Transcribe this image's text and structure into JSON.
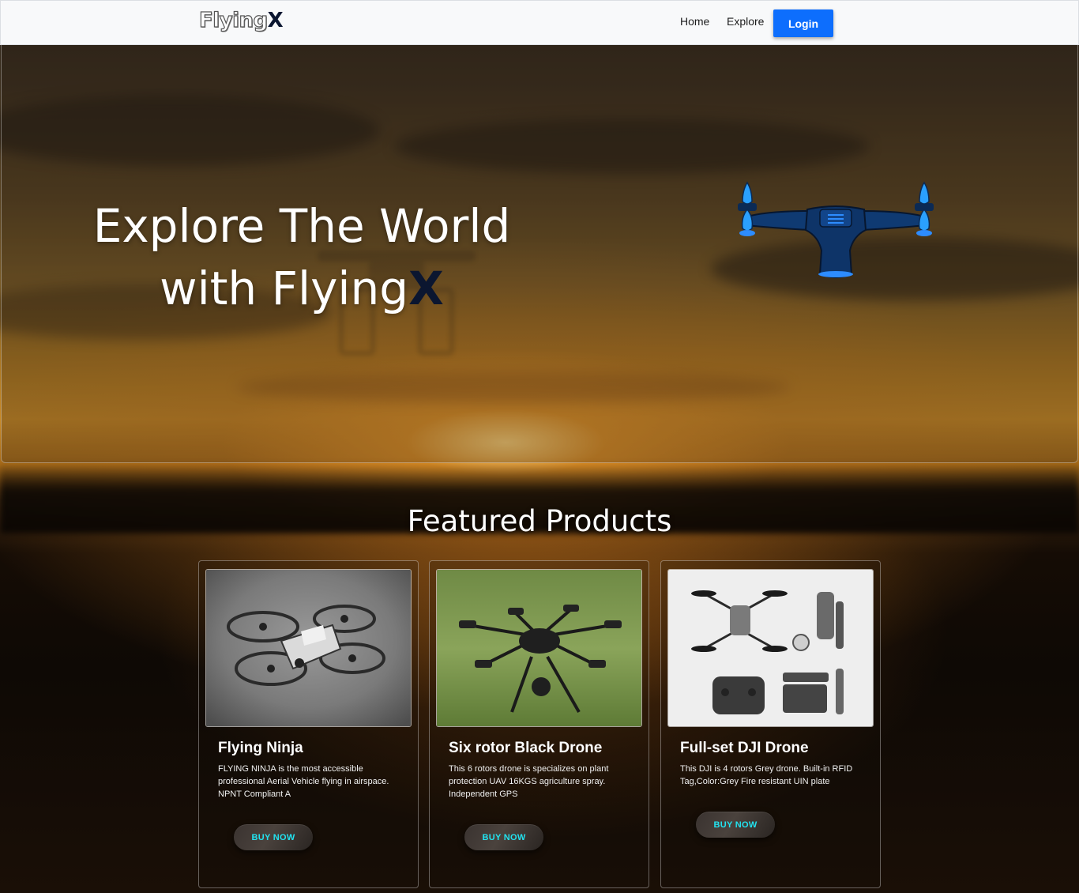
{
  "navbar": {
    "brand_part1": "Flying",
    "brand_part2": "X",
    "links": [
      {
        "label": "Home"
      },
      {
        "label": "Explore"
      }
    ],
    "login_label": "Login"
  },
  "hero": {
    "title_line1": "Explore The World",
    "title_line2_prefix": "with Flying",
    "title_line2_accent": "X"
  },
  "featured": {
    "heading": "Featured Products",
    "products": [
      {
        "title": "Flying Ninja",
        "description": "FLYING NINJA is the most accessible professional Aerial Vehicle flying in airspace. NPNT Compliant A",
        "button": "BUY NOW"
      },
      {
        "title": "Six rotor Black Drone",
        "description": "This 6 rotors drone is specializes on plant protection UAV 16KGS agriculture spray. Independent GPS",
        "button": "BUY NOW"
      },
      {
        "title": "Full-set DJI Drone",
        "description": "This DJI is 4 rotors Grey drone. Built-in RFID Tag,Color:Grey Fire resistant UIN plate",
        "button": "BUY NOW"
      }
    ]
  },
  "colors": {
    "accent_blue": "#0d6efd",
    "brand_dark": "#0b1630",
    "buy_text": "#22e3f0"
  }
}
